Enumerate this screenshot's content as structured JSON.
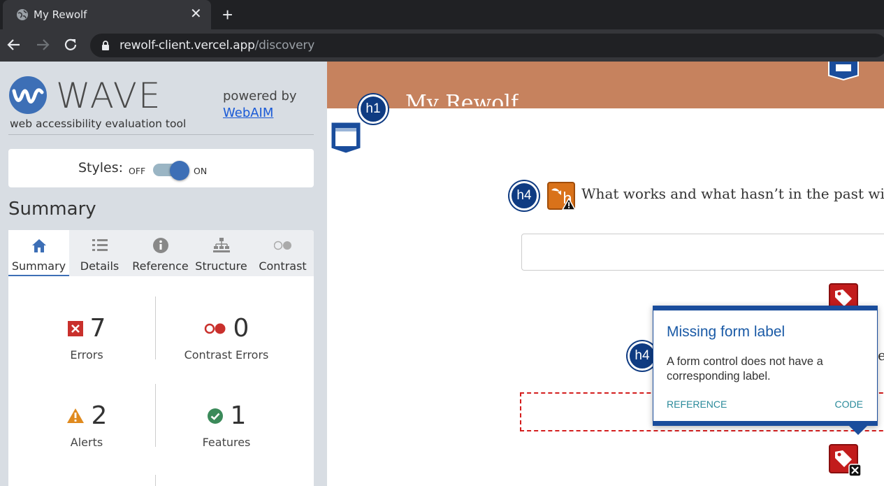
{
  "browser": {
    "tab_title": "My Rewolf",
    "tab_close": "✕",
    "new_tab": "+",
    "url_host": "rewolf-client.vercel.app",
    "url_path": "/discovery"
  },
  "wave": {
    "title": "WAVE",
    "subtitle": "web accessibility evaluation tool",
    "powered_by": "powered by",
    "webaim_link": "WebAIM",
    "styles_label": "Styles:",
    "styles_off": "OFF",
    "styles_on": "ON",
    "styles_enabled": true,
    "summary_heading": "Summary",
    "tabs": [
      {
        "label": "Summary",
        "icon": "home-icon",
        "active": true
      },
      {
        "label": "Details",
        "icon": "list-icon",
        "active": false
      },
      {
        "label": "Reference",
        "icon": "info-icon",
        "active": false
      },
      {
        "label": "Structure",
        "icon": "structure-icon",
        "active": false
      },
      {
        "label": "Contrast",
        "icon": "contrast-icon",
        "active": false
      }
    ],
    "stats": {
      "errors": {
        "count": "7",
        "label": "Errors",
        "color": "#c9302c"
      },
      "contrast_errors": {
        "count": "0",
        "label": "Contrast Errors",
        "color": "#c9302c"
      },
      "alerts": {
        "count": "2",
        "label": "Alerts",
        "color": "#e08a1e"
      },
      "features": {
        "count": "1",
        "label": "Features",
        "color": "#3b8a5a"
      }
    }
  },
  "page": {
    "site_title": "My Rewolf",
    "header_color": "#c6825e",
    "question": "What works and what hasn’t in the past with so",
    "question2_fragment": "er",
    "badges": {
      "h1": "h1",
      "h4a": "h4",
      "h4b": "h4"
    }
  },
  "tooltip": {
    "title": "Missing form label",
    "body": "A form control does not have a corresponding label.",
    "reference": "REFERENCE",
    "code": "CODE"
  }
}
